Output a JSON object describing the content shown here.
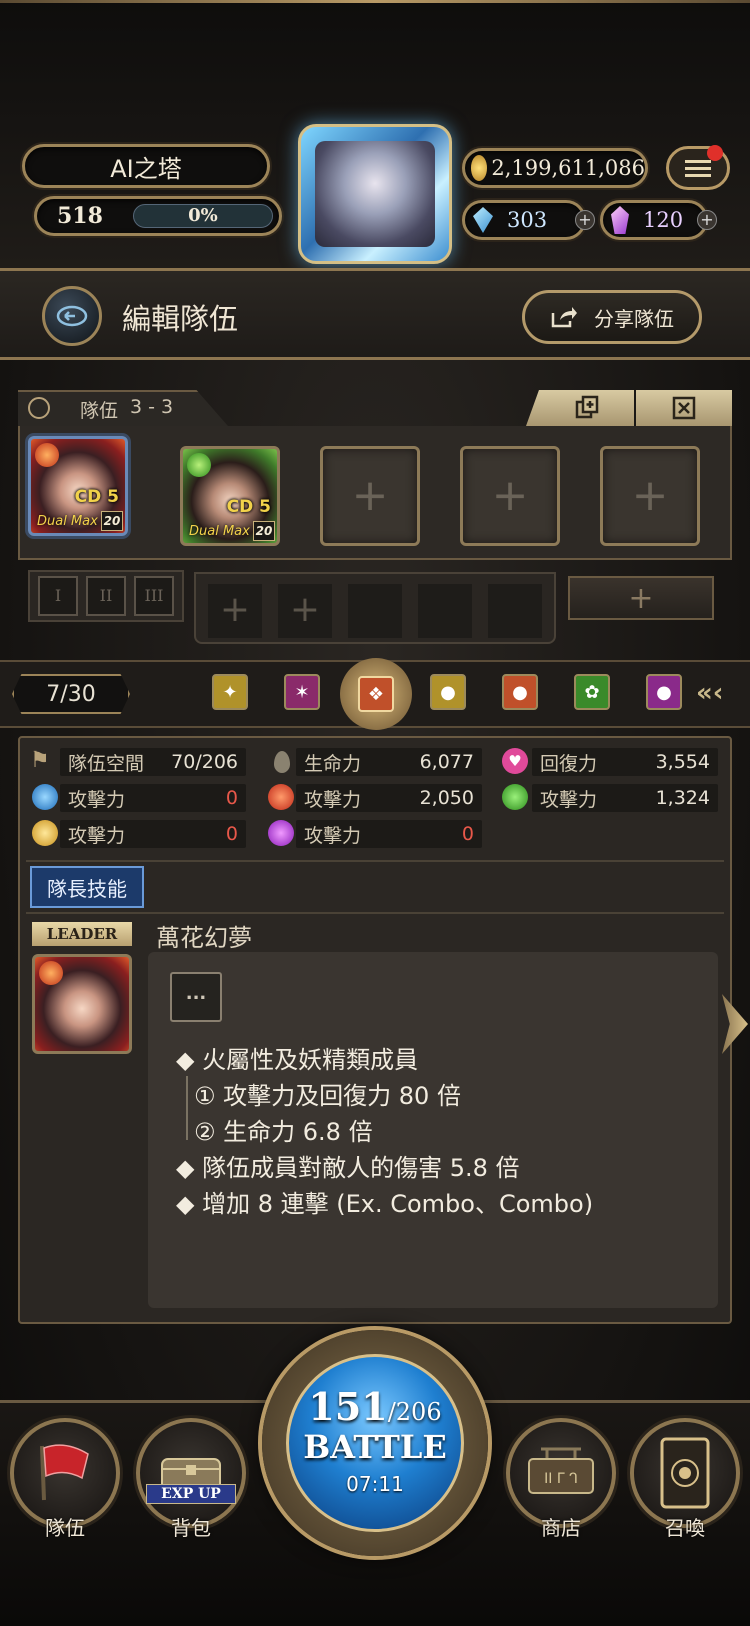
{
  "header": {
    "location": "AI之塔",
    "gold": "2,199,611,086",
    "level": "518",
    "exp_percent_label": "0%",
    "exp_fraction": 0.0,
    "diamonds": "303",
    "soul_crystals": "120"
  },
  "edit_team": {
    "title": "編輯隊伍",
    "share_label": "分享隊伍"
  },
  "team": {
    "label": "隊伍",
    "index": "3 - 3",
    "cards": [
      {
        "element": "fire",
        "cd": "CD 5",
        "badge": "Dual Max",
        "level": "20"
      },
      {
        "element": "wood",
        "cd": "CD 5",
        "badge": "Dual Max",
        "level": "20"
      }
    ],
    "empty_slots": 3,
    "formation_tabs": [
      "I",
      "II",
      "III"
    ]
  },
  "filter": {
    "count": "7/30"
  },
  "stats": {
    "space_label": "隊伍空間",
    "space_value": "70/206",
    "hp_label": "生命力",
    "hp_value": "6,077",
    "recovery_label": "回復力",
    "recovery_value": "3,554",
    "water_atk_label": "攻擊力",
    "water_atk_value": "0",
    "fire_atk_label": "攻擊力",
    "fire_atk_value": "2,050",
    "wood_atk_label": "攻擊力",
    "wood_atk_value": "1,324",
    "light_atk_label": "攻擊力",
    "light_atk_value": "0",
    "dark_atk_label": "攻擊力",
    "dark_atk_value": "0"
  },
  "leader": {
    "section_tab": "隊長技能",
    "badge": "LEADER",
    "skill_name": "萬花幻夢",
    "more_label": "...",
    "lines": [
      "◆ 火屬性及妖精類成員",
      "① 攻擊力及回復力 80 倍",
      "② 生命力 6.8 倍",
      "◆ 隊伍成員對敵人的傷害 5.8 倍",
      "◆ 增加 8 連擊 (Ex. Combo、Combo)"
    ]
  },
  "bottom_nav": {
    "team_label": "隊伍",
    "bag_label": "背包",
    "bag_badge": "EXP UP",
    "stamina_current": "151",
    "stamina_max": "/206",
    "battle_label": "BATTLE",
    "timer": "07:11",
    "shop_label": "商店",
    "summon_label": "召喚"
  },
  "colors": {
    "gold": "#c7a86a",
    "fire": "#d8432a",
    "wood": "#4aa83a",
    "water": "#2a8ad8",
    "light": "#e0b83a",
    "dark": "#b03ad0",
    "value_red": "#e8584a",
    "battle_blue": "#1f7fd0"
  }
}
